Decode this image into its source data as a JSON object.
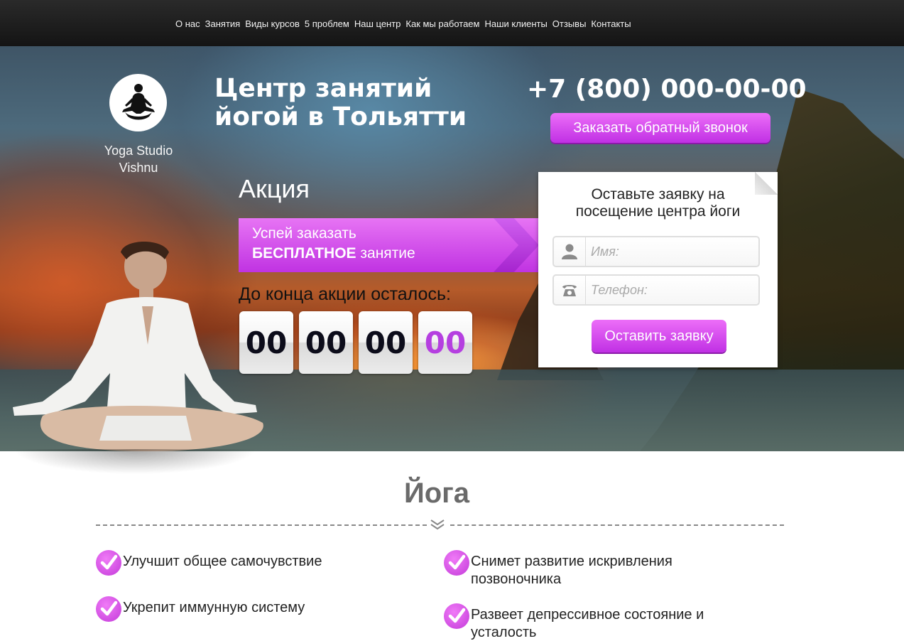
{
  "nav": {
    "items": [
      "О нас",
      "Занятия",
      "Виды курсов",
      "5 проблем",
      "Наш центр",
      "Как мы работаем",
      "Наши клиенты",
      "Отзывы",
      "Контакты"
    ]
  },
  "hero": {
    "logo_text_line1": "Yoga Studio",
    "logo_text_line2": "Vishnu",
    "title_line1": "Центр занятий",
    "title_line2": "йогой в Тольятти",
    "phone": "+7 (800) 000-00-00",
    "callback_button": "Заказать обратный звонок",
    "promo_heading": "Акция",
    "promo_line1": "Успей заказать",
    "promo_bold": "БЕСПЛАТНОЕ",
    "promo_rest": " занятие",
    "countdown_label": "До конца акции осталось:",
    "timer": [
      "00",
      "00",
      "00",
      "00"
    ]
  },
  "form": {
    "title_line1": "Оставьте заявку на",
    "title_line2": "посещение центра йоги",
    "name_placeholder": "Имя:",
    "phone_placeholder": "Телефон:",
    "submit_label": "Оставить заявку"
  },
  "benefits": {
    "title": "Йога",
    "left": [
      "Улучшит общее самочувствие",
      "Укрепит иммунную систему"
    ],
    "right_1_line1": "Снимет развитие искривления",
    "right_1_line2": "позвоночника",
    "right_2_line1": "Развеет депрессивное состояние и",
    "right_2_line2": "усталость"
  },
  "colors": {
    "accent": "#c43ae2",
    "nav_bg": "#1c1c1c"
  }
}
